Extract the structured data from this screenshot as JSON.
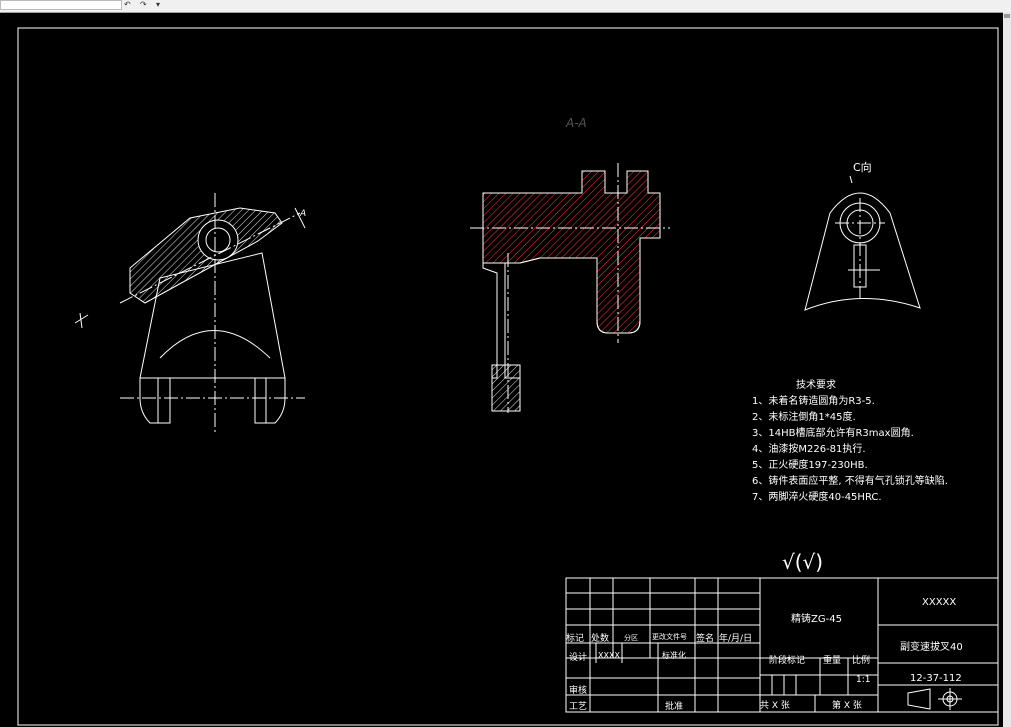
{
  "toolbar": {
    "icons": [
      "undo-icon",
      "redo-icon",
      "dropdown-icon"
    ]
  },
  "drawing": {
    "section_label": "A-A",
    "view_label": "C向",
    "marker_a": "A",
    "requirements_title": "技术要求",
    "requirements": [
      "1、未着名铸造圆角为R3-5.",
      "2、未标注倒角1*45度.",
      "3、14HB槽底部允许有R3max圆角.",
      "4、油漆按M226-81执行.",
      "5、正火硬度197-230HB.",
      "6、铸件表面应平整, 不得有气孔锁孔等缺陷.",
      "7、两脚淬火硬度40-45HRC."
    ],
    "roughness_symbol": "√(√)"
  },
  "title_block": {
    "material": "精铸ZG-45",
    "company": "XXXXX",
    "part_name": "副变速拔叉40",
    "drawing_number": "12-37-112",
    "row_labels": [
      "标记",
      "处数",
      "分区",
      "更改文件号",
      "签名",
      "年/月/日"
    ],
    "design_label": "设计",
    "design_value": "XXXX",
    "standardize_label": "标准化",
    "review_label": "审核",
    "process_label": "工艺",
    "approve_label": "批准",
    "stage_label": "阶段标记",
    "weight_label": "重量",
    "scale_label": "比例",
    "scale_value": "1:1",
    "sheet_total": "共 X 张",
    "sheet_current": "第 X 张"
  },
  "colors": {
    "background": "#000000",
    "line": "#ffffff",
    "accent": "#ff0000"
  }
}
